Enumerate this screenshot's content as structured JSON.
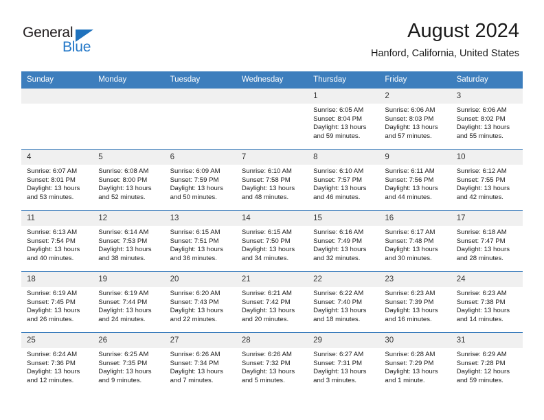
{
  "brand": {
    "name_top": "General",
    "name_bottom": "Blue",
    "accent_color": "#2277c8",
    "triangle_color": "#1f72bd"
  },
  "header": {
    "title": "August 2024",
    "subtitle": "Hanford, California, United States"
  },
  "calendar": {
    "header_bg": "#3d7ebd",
    "daynum_bg": "#f0f0f0",
    "weekdays": [
      "Sunday",
      "Monday",
      "Tuesday",
      "Wednesday",
      "Thursday",
      "Friday",
      "Saturday"
    ],
    "weeks": [
      [
        {
          "day": "",
          "empty": true
        },
        {
          "day": "",
          "empty": true
        },
        {
          "day": "",
          "empty": true
        },
        {
          "day": "",
          "empty": true
        },
        {
          "day": "1",
          "sunrise": "Sunrise: 6:05 AM",
          "sunset": "Sunset: 8:04 PM",
          "daylight_1": "Daylight: 13 hours",
          "daylight_2": "and 59 minutes."
        },
        {
          "day": "2",
          "sunrise": "Sunrise: 6:06 AM",
          "sunset": "Sunset: 8:03 PM",
          "daylight_1": "Daylight: 13 hours",
          "daylight_2": "and 57 minutes."
        },
        {
          "day": "3",
          "sunrise": "Sunrise: 6:06 AM",
          "sunset": "Sunset: 8:02 PM",
          "daylight_1": "Daylight: 13 hours",
          "daylight_2": "and 55 minutes."
        }
      ],
      [
        {
          "day": "4",
          "sunrise": "Sunrise: 6:07 AM",
          "sunset": "Sunset: 8:01 PM",
          "daylight_1": "Daylight: 13 hours",
          "daylight_2": "and 53 minutes."
        },
        {
          "day": "5",
          "sunrise": "Sunrise: 6:08 AM",
          "sunset": "Sunset: 8:00 PM",
          "daylight_1": "Daylight: 13 hours",
          "daylight_2": "and 52 minutes."
        },
        {
          "day": "6",
          "sunrise": "Sunrise: 6:09 AM",
          "sunset": "Sunset: 7:59 PM",
          "daylight_1": "Daylight: 13 hours",
          "daylight_2": "and 50 minutes."
        },
        {
          "day": "7",
          "sunrise": "Sunrise: 6:10 AM",
          "sunset": "Sunset: 7:58 PM",
          "daylight_1": "Daylight: 13 hours",
          "daylight_2": "and 48 minutes."
        },
        {
          "day": "8",
          "sunrise": "Sunrise: 6:10 AM",
          "sunset": "Sunset: 7:57 PM",
          "daylight_1": "Daylight: 13 hours",
          "daylight_2": "and 46 minutes."
        },
        {
          "day": "9",
          "sunrise": "Sunrise: 6:11 AM",
          "sunset": "Sunset: 7:56 PM",
          "daylight_1": "Daylight: 13 hours",
          "daylight_2": "and 44 minutes."
        },
        {
          "day": "10",
          "sunrise": "Sunrise: 6:12 AM",
          "sunset": "Sunset: 7:55 PM",
          "daylight_1": "Daylight: 13 hours",
          "daylight_2": "and 42 minutes."
        }
      ],
      [
        {
          "day": "11",
          "sunrise": "Sunrise: 6:13 AM",
          "sunset": "Sunset: 7:54 PM",
          "daylight_1": "Daylight: 13 hours",
          "daylight_2": "and 40 minutes."
        },
        {
          "day": "12",
          "sunrise": "Sunrise: 6:14 AM",
          "sunset": "Sunset: 7:53 PM",
          "daylight_1": "Daylight: 13 hours",
          "daylight_2": "and 38 minutes."
        },
        {
          "day": "13",
          "sunrise": "Sunrise: 6:15 AM",
          "sunset": "Sunset: 7:51 PM",
          "daylight_1": "Daylight: 13 hours",
          "daylight_2": "and 36 minutes."
        },
        {
          "day": "14",
          "sunrise": "Sunrise: 6:15 AM",
          "sunset": "Sunset: 7:50 PM",
          "daylight_1": "Daylight: 13 hours",
          "daylight_2": "and 34 minutes."
        },
        {
          "day": "15",
          "sunrise": "Sunrise: 6:16 AM",
          "sunset": "Sunset: 7:49 PM",
          "daylight_1": "Daylight: 13 hours",
          "daylight_2": "and 32 minutes."
        },
        {
          "day": "16",
          "sunrise": "Sunrise: 6:17 AM",
          "sunset": "Sunset: 7:48 PM",
          "daylight_1": "Daylight: 13 hours",
          "daylight_2": "and 30 minutes."
        },
        {
          "day": "17",
          "sunrise": "Sunrise: 6:18 AM",
          "sunset": "Sunset: 7:47 PM",
          "daylight_1": "Daylight: 13 hours",
          "daylight_2": "and 28 minutes."
        }
      ],
      [
        {
          "day": "18",
          "sunrise": "Sunrise: 6:19 AM",
          "sunset": "Sunset: 7:45 PM",
          "daylight_1": "Daylight: 13 hours",
          "daylight_2": "and 26 minutes."
        },
        {
          "day": "19",
          "sunrise": "Sunrise: 6:19 AM",
          "sunset": "Sunset: 7:44 PM",
          "daylight_1": "Daylight: 13 hours",
          "daylight_2": "and 24 minutes."
        },
        {
          "day": "20",
          "sunrise": "Sunrise: 6:20 AM",
          "sunset": "Sunset: 7:43 PM",
          "daylight_1": "Daylight: 13 hours",
          "daylight_2": "and 22 minutes."
        },
        {
          "day": "21",
          "sunrise": "Sunrise: 6:21 AM",
          "sunset": "Sunset: 7:42 PM",
          "daylight_1": "Daylight: 13 hours",
          "daylight_2": "and 20 minutes."
        },
        {
          "day": "22",
          "sunrise": "Sunrise: 6:22 AM",
          "sunset": "Sunset: 7:40 PM",
          "daylight_1": "Daylight: 13 hours",
          "daylight_2": "and 18 minutes."
        },
        {
          "day": "23",
          "sunrise": "Sunrise: 6:23 AM",
          "sunset": "Sunset: 7:39 PM",
          "daylight_1": "Daylight: 13 hours",
          "daylight_2": "and 16 minutes."
        },
        {
          "day": "24",
          "sunrise": "Sunrise: 6:23 AM",
          "sunset": "Sunset: 7:38 PM",
          "daylight_1": "Daylight: 13 hours",
          "daylight_2": "and 14 minutes."
        }
      ],
      [
        {
          "day": "25",
          "sunrise": "Sunrise: 6:24 AM",
          "sunset": "Sunset: 7:36 PM",
          "daylight_1": "Daylight: 13 hours",
          "daylight_2": "and 12 minutes."
        },
        {
          "day": "26",
          "sunrise": "Sunrise: 6:25 AM",
          "sunset": "Sunset: 7:35 PM",
          "daylight_1": "Daylight: 13 hours",
          "daylight_2": "and 9 minutes."
        },
        {
          "day": "27",
          "sunrise": "Sunrise: 6:26 AM",
          "sunset": "Sunset: 7:34 PM",
          "daylight_1": "Daylight: 13 hours",
          "daylight_2": "and 7 minutes."
        },
        {
          "day": "28",
          "sunrise": "Sunrise: 6:26 AM",
          "sunset": "Sunset: 7:32 PM",
          "daylight_1": "Daylight: 13 hours",
          "daylight_2": "and 5 minutes."
        },
        {
          "day": "29",
          "sunrise": "Sunrise: 6:27 AM",
          "sunset": "Sunset: 7:31 PM",
          "daylight_1": "Daylight: 13 hours",
          "daylight_2": "and 3 minutes."
        },
        {
          "day": "30",
          "sunrise": "Sunrise: 6:28 AM",
          "sunset": "Sunset: 7:29 PM",
          "daylight_1": "Daylight: 13 hours",
          "daylight_2": "and 1 minute."
        },
        {
          "day": "31",
          "sunrise": "Sunrise: 6:29 AM",
          "sunset": "Sunset: 7:28 PM",
          "daylight_1": "Daylight: 12 hours",
          "daylight_2": "and 59 minutes."
        }
      ]
    ]
  }
}
